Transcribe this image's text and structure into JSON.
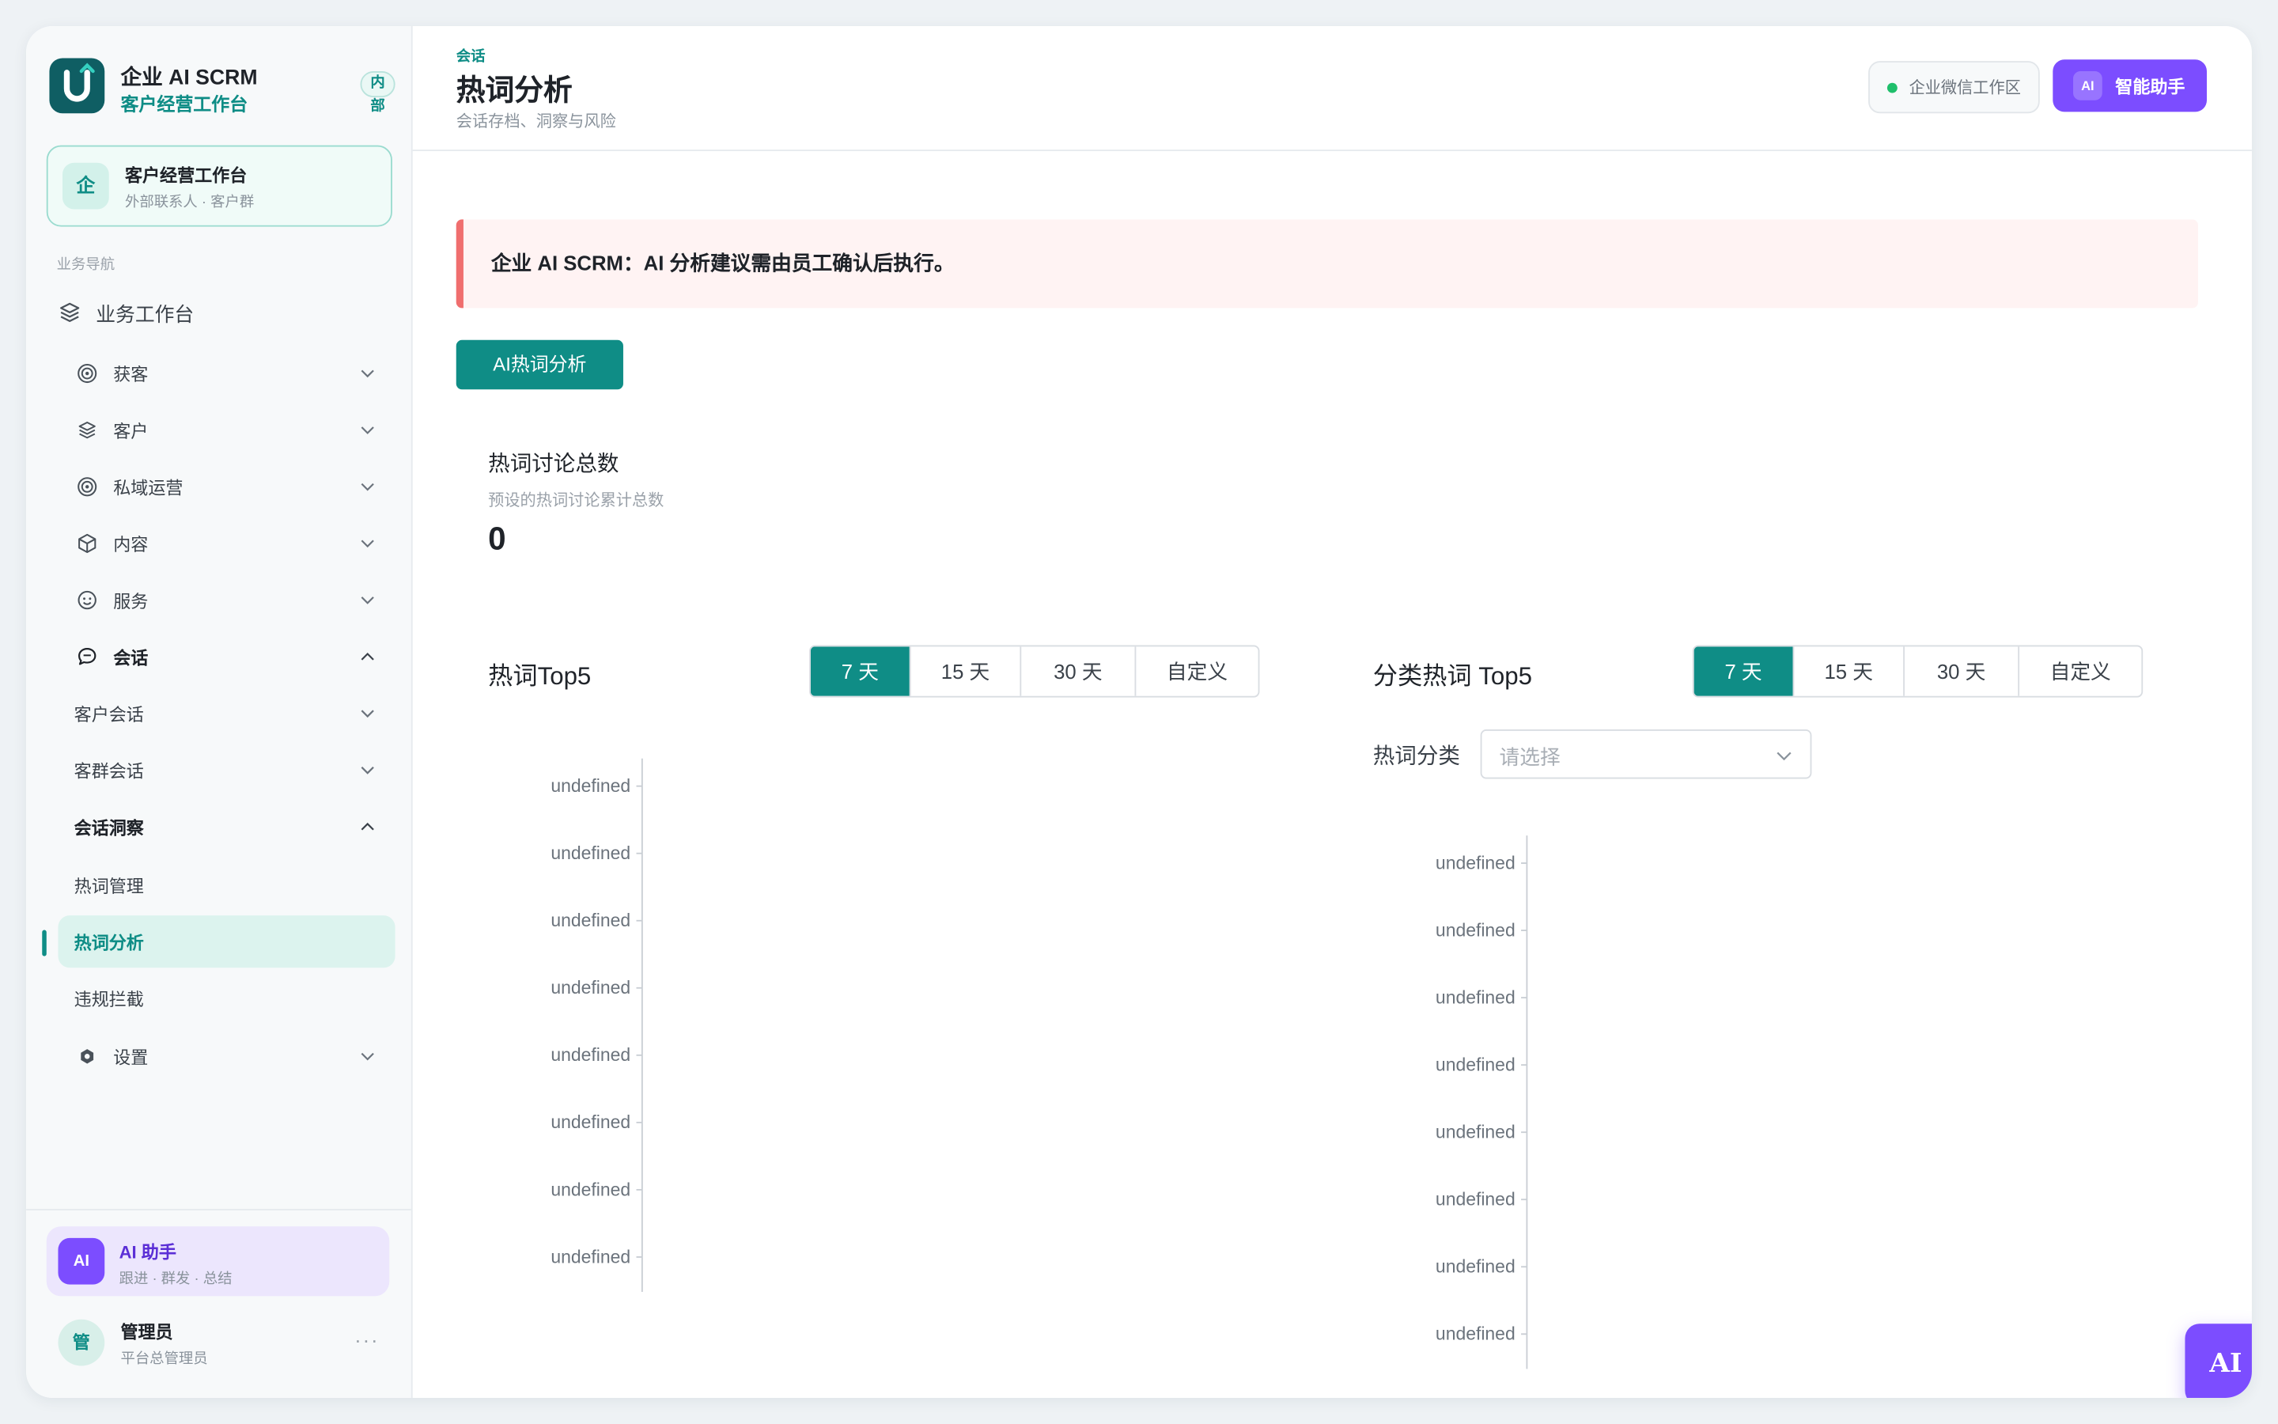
{
  "brand": {
    "title": "企业 AI SCRM",
    "subtitle": "客户经营工作台",
    "badge": "内部"
  },
  "workspace_card": {
    "icon": "企",
    "title": "客户经营工作台",
    "subtitle": "外部联系人 · 客户群"
  },
  "nav": {
    "section_label": "业务导航",
    "home": "业务工作台",
    "items": {
      "acquire": "获客",
      "customer": "客户",
      "private": "私域运营",
      "content": "内容",
      "service": "服务",
      "conversation": "会话",
      "customer_conv": "客户会话",
      "group_conv": "客群会话",
      "insight": "会话洞察",
      "hotword_manage": "热词管理",
      "hotword_analysis": "热词分析",
      "violation": "违规拦截",
      "settings": "设置"
    }
  },
  "ai_card": {
    "avatar": "AI",
    "title": "AI 助手",
    "subtitle": "跟进 · 群发 · 总结"
  },
  "user": {
    "avatar": "管",
    "name": "管理员",
    "role": "平台总管理员",
    "more": "···"
  },
  "header": {
    "breadcrumb": "会话",
    "title": "热词分析",
    "subtitle": "会话存档、洞察与风险",
    "workspace_pill": "企业微信工作区",
    "assistant_icon": "AI",
    "assistant_label": "智能助手"
  },
  "notice": "企业 AI SCRM：AI 分析建议需由员工确认后执行。",
  "ai_analyze_button": "AI热词分析",
  "stat": {
    "title": "热词讨论总数",
    "desc": "预设的热词讨论累计总数",
    "value": "0"
  },
  "range_options": [
    "7 天",
    "15 天",
    "30 天",
    "自定义"
  ],
  "range_selected": "7 天",
  "chart_left_title": "热词Top5",
  "chart_right_title": "分类热词 Top5",
  "filter": {
    "label": "热词分类",
    "placeholder": "请选择"
  },
  "fab_label": "AI",
  "colors": {
    "primary": "#0f8d86",
    "ai_purple": "#7c4dff",
    "notice_bg": "#fff3f3",
    "notice_bar": "#f06e6e"
  },
  "chart_data": [
    {
      "type": "bar",
      "title": "热词Top5",
      "categories": [
        "undefined",
        "undefined",
        "undefined",
        "undefined",
        "undefined",
        "undefined",
        "undefined",
        "undefined"
      ],
      "values": [],
      "xlabel": "",
      "ylabel": ""
    },
    {
      "type": "bar",
      "title": "分类热词 Top5",
      "categories": [
        "undefined",
        "undefined",
        "undefined",
        "undefined",
        "undefined",
        "undefined",
        "undefined",
        "undefined"
      ],
      "values": [],
      "xlabel": "",
      "ylabel": ""
    }
  ]
}
